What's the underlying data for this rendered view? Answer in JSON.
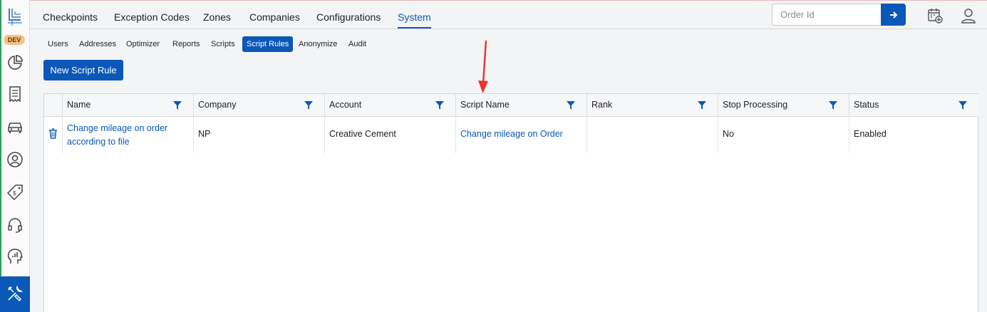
{
  "app": {
    "env_badge": "DEV"
  },
  "sidebar": {
    "items": [
      {
        "icon": "pie-chart-icon"
      },
      {
        "icon": "receipt-icon"
      },
      {
        "icon": "car-icon"
      },
      {
        "icon": "user-circle-icon"
      },
      {
        "icon": "price-tag-icon"
      },
      {
        "icon": "headset-icon"
      },
      {
        "icon": "analytics-head-icon"
      },
      {
        "icon": "tools-icon",
        "active": true
      }
    ]
  },
  "topnav": {
    "tabs": [
      {
        "label": "Checkpoints"
      },
      {
        "label": "Exception Codes"
      },
      {
        "label": "Zones"
      },
      {
        "label": "Companies"
      },
      {
        "label": "Configurations"
      },
      {
        "label": "System",
        "active": true
      }
    ],
    "order_search": {
      "placeholder": "Order Id",
      "value": ""
    }
  },
  "subnav": {
    "tabs": [
      {
        "label": "Users"
      },
      {
        "label": "Addresses"
      },
      {
        "label": "Optimizer"
      },
      {
        "label": "Reports"
      },
      {
        "label": "Scripts"
      },
      {
        "label": "Script Rules",
        "active": true
      },
      {
        "label": "Anonymize"
      },
      {
        "label": "Audit"
      }
    ]
  },
  "actions": {
    "new_button": "New Script Rule"
  },
  "table": {
    "columns": [
      "Name",
      "Company",
      "Account",
      "Script Name",
      "Rank",
      "Stop Processing",
      "Status"
    ],
    "rows": [
      {
        "name": "Change mileage on order according to file",
        "company": "NP",
        "account": "Creative Cement",
        "script_name": "Change mileage on Order",
        "rank": "",
        "stop_processing": "No",
        "status": "Enabled"
      }
    ]
  },
  "colors": {
    "accent": "#0a58b8",
    "annotation_arrow": "#e8372a",
    "env_badge": "#f6c184"
  }
}
